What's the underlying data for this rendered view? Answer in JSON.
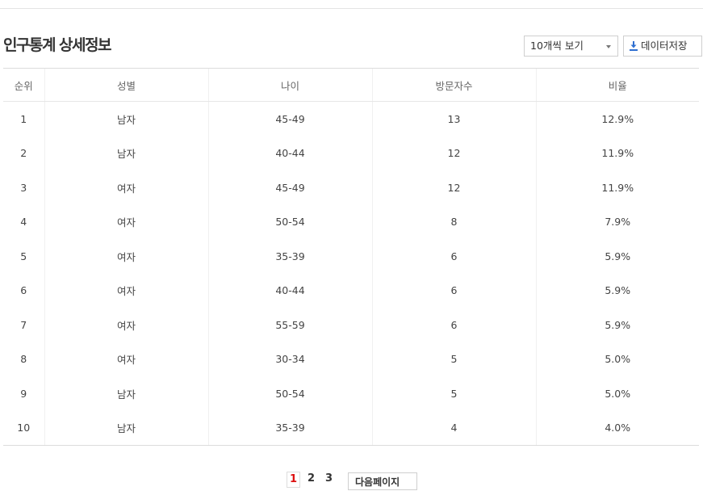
{
  "section": {
    "title": "인구통계 상세정보"
  },
  "controls": {
    "page_size": "10개씩 보기",
    "download_label": "데이터저장"
  },
  "table": {
    "headers": [
      "순위",
      "성별",
      "나이",
      "방문자수",
      "비율"
    ],
    "rows": [
      [
        "1",
        "남자",
        "45-49",
        "13",
        "12.9%"
      ],
      [
        "2",
        "남자",
        "40-44",
        "12",
        "11.9%"
      ],
      [
        "3",
        "여자",
        "45-49",
        "12",
        "11.9%"
      ],
      [
        "4",
        "여자",
        "50-54",
        "8",
        "7.9%"
      ],
      [
        "5",
        "여자",
        "35-39",
        "6",
        "5.9%"
      ],
      [
        "6",
        "여자",
        "40-44",
        "6",
        "5.9%"
      ],
      [
        "7",
        "여자",
        "55-59",
        "6",
        "5.9%"
      ],
      [
        "8",
        "여자",
        "30-34",
        "5",
        "5.0%"
      ],
      [
        "9",
        "남자",
        "50-54",
        "5",
        "5.0%"
      ],
      [
        "10",
        "남자",
        "35-39",
        "4",
        "4.0%"
      ]
    ]
  },
  "pagination": {
    "pages": [
      "1",
      "2",
      "3"
    ],
    "current": "1",
    "next_label": "다음페이지"
  },
  "colors": {
    "accent_download_icon": "#2f6fd1",
    "current_page": "#dd1111"
  },
  "icons": {
    "download": "download-icon",
    "dropdown": "chevron-down-icon"
  }
}
